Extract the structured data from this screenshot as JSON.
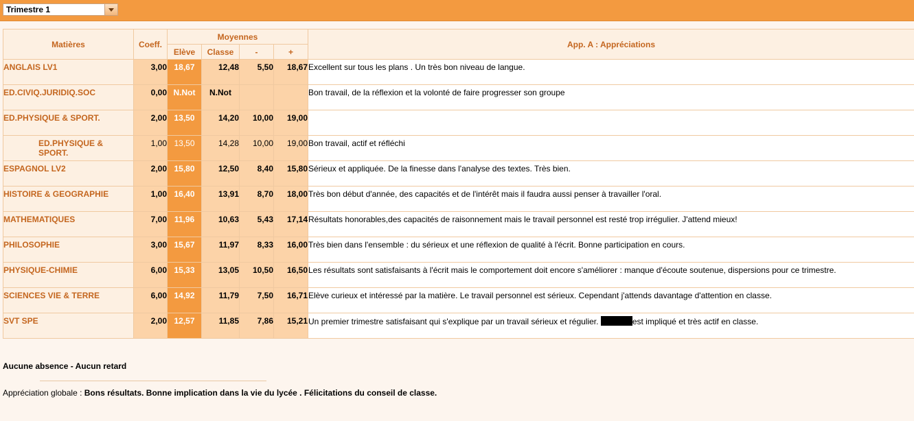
{
  "period_select": {
    "value": "Trimestre 1"
  },
  "headers": {
    "subjects": "Matières",
    "coeff": "Coeff.",
    "averages": "Moyennes",
    "student": "Elève",
    "class": "Classe",
    "min": "-",
    "max": "+",
    "appreciations": "App. A : Appréciations"
  },
  "rows": [
    {
      "subject": "ANGLAIS LV1",
      "coeff": "3,00",
      "eleve": "18,67",
      "classe": "12,48",
      "min": "5,50",
      "max": "18,67",
      "appreciation": "Excellent sur tous les plans . Un très bon niveau de langue."
    },
    {
      "subject": "ED.CIVIQ.JURIDIQ.SOC",
      "coeff": "0,00",
      "eleve": "N.Not",
      "classe": "N.Not",
      "min": "",
      "max": "",
      "appreciation": "Bon travail, de la réflexion et la volonté de faire progresser son groupe"
    },
    {
      "subject": "ED.PHYSIQUE & SPORT.",
      "coeff": "2,00",
      "eleve": "13,50",
      "classe": "14,20",
      "min": "10,00",
      "max": "19,00",
      "appreciation": ""
    },
    {
      "subject": "ED.PHYSIQUE & SPORT.",
      "coeff": "1,00",
      "eleve": "13,50",
      "classe": "14,28",
      "min": "10,00",
      "max": "19,00",
      "appreciation": "Bon travail, actif et réfléchi"
    },
    {
      "subject": "ESPAGNOL LV2",
      "coeff": "2,00",
      "eleve": "15,80",
      "classe": "12,50",
      "min": "8,40",
      "max": "15,80",
      "appreciation": "Sérieux et appliquée. De la finesse dans l'analyse des textes. Très bien."
    },
    {
      "subject": "HISTOIRE & GEOGRAPHIE",
      "coeff": "1,00",
      "eleve": "16,40",
      "classe": "13,91",
      "min": "8,70",
      "max": "18,00",
      "appreciation": "Très bon début d'année, des capacités et de l'intérêt mais il faudra aussi penser à travailler l'oral."
    },
    {
      "subject": "MATHEMATIQUES",
      "coeff": "7,00",
      "eleve": "11,96",
      "classe": "10,63",
      "min": "5,43",
      "max": "17,14",
      "appreciation": "Résultats honorables,des capacités de raisonnement mais le travail personnel est resté trop irrégulier. J'attend mieux!"
    },
    {
      "subject": "PHILOSOPHIE",
      "coeff": "3,00",
      "eleve": "15,67",
      "classe": "11,97",
      "min": "8,33",
      "max": "16,00",
      "appreciation": "Très bien dans l'ensemble : du sérieux et une réflexion de qualité à l'écrit. Bonne participation en cours."
    },
    {
      "subject": "PHYSIQUE-CHIMIE",
      "coeff": "6,00",
      "eleve": "15,33",
      "classe": "13,05",
      "min": "10,50",
      "max": "16,50",
      "appreciation": "Les résultats sont satisfaisants à l'écrit mais le comportement doit encore s'améliorer : manque d'écoute soutenue, dispersions pour ce trimestre."
    },
    {
      "subject": "SCIENCES VIE & TERRE",
      "coeff": "6,00",
      "eleve": "14,92",
      "classe": "11,79",
      "min": "7,50",
      "max": "16,71",
      "appreciation": "Elève curieux et intéressé par la matière. Le travail personnel est sérieux. Cependant j'attends davantage d'attention en classe."
    },
    {
      "subject": "SVT SPE",
      "coeff": "2,00",
      "eleve": "12,57",
      "classe": "11,85",
      "min": "7,86",
      "max": "15,21",
      "appreciation_before": "Un premier trimestre satisfaisant qui s'explique par un travail sérieux et régulier.",
      "appreciation_after": "est impliqué et très actif en classe."
    }
  ],
  "absence": "Aucune absence - Aucun retard",
  "global": {
    "label": "Appréciation globale :",
    "value": "Bons résultats. Bonne implication dans la vie du lycée . Félicitations du conseil de classe."
  }
}
